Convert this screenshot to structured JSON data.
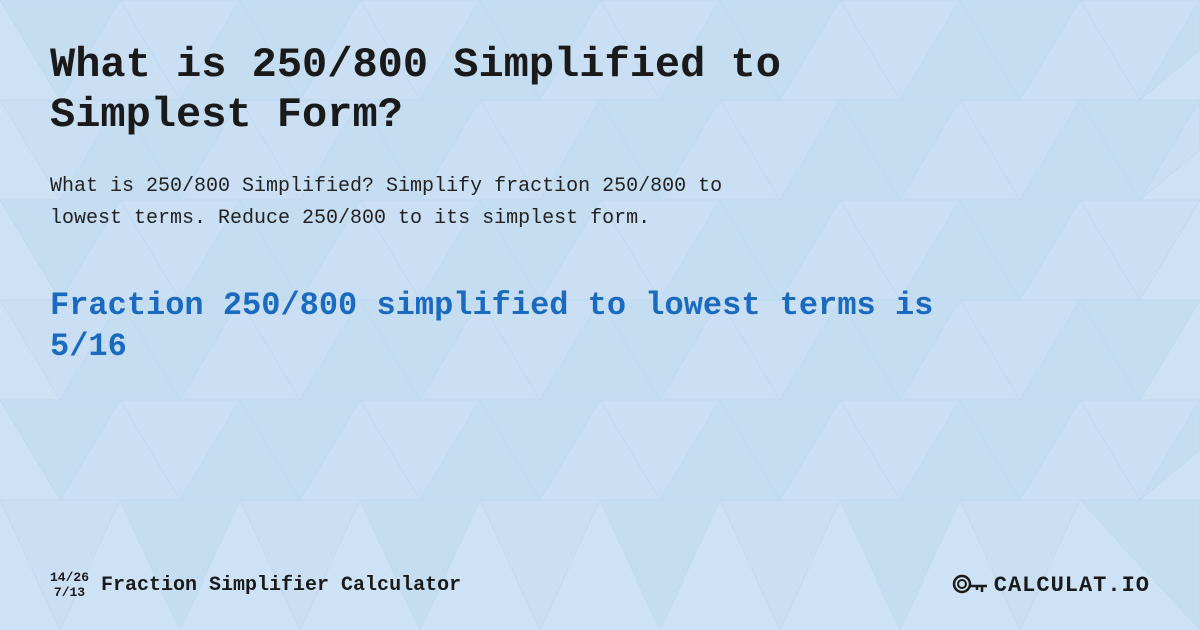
{
  "page": {
    "title": "What is 250/800 Simplified to Simplest Form?",
    "description": "What is 250/800 Simplified? Simplify fraction 250/800 to lowest terms. Reduce 250/800 to its simplest form.",
    "result": "Fraction 250/800 simplified to lowest terms is 5/16",
    "footer": {
      "fraction_top": "14/26",
      "fraction_bottom": "7/13",
      "brand_name": "Fraction Simplifier Calculator",
      "logo_text": "CALCULAT.IO"
    }
  },
  "background": {
    "color": "#cce0f5"
  }
}
